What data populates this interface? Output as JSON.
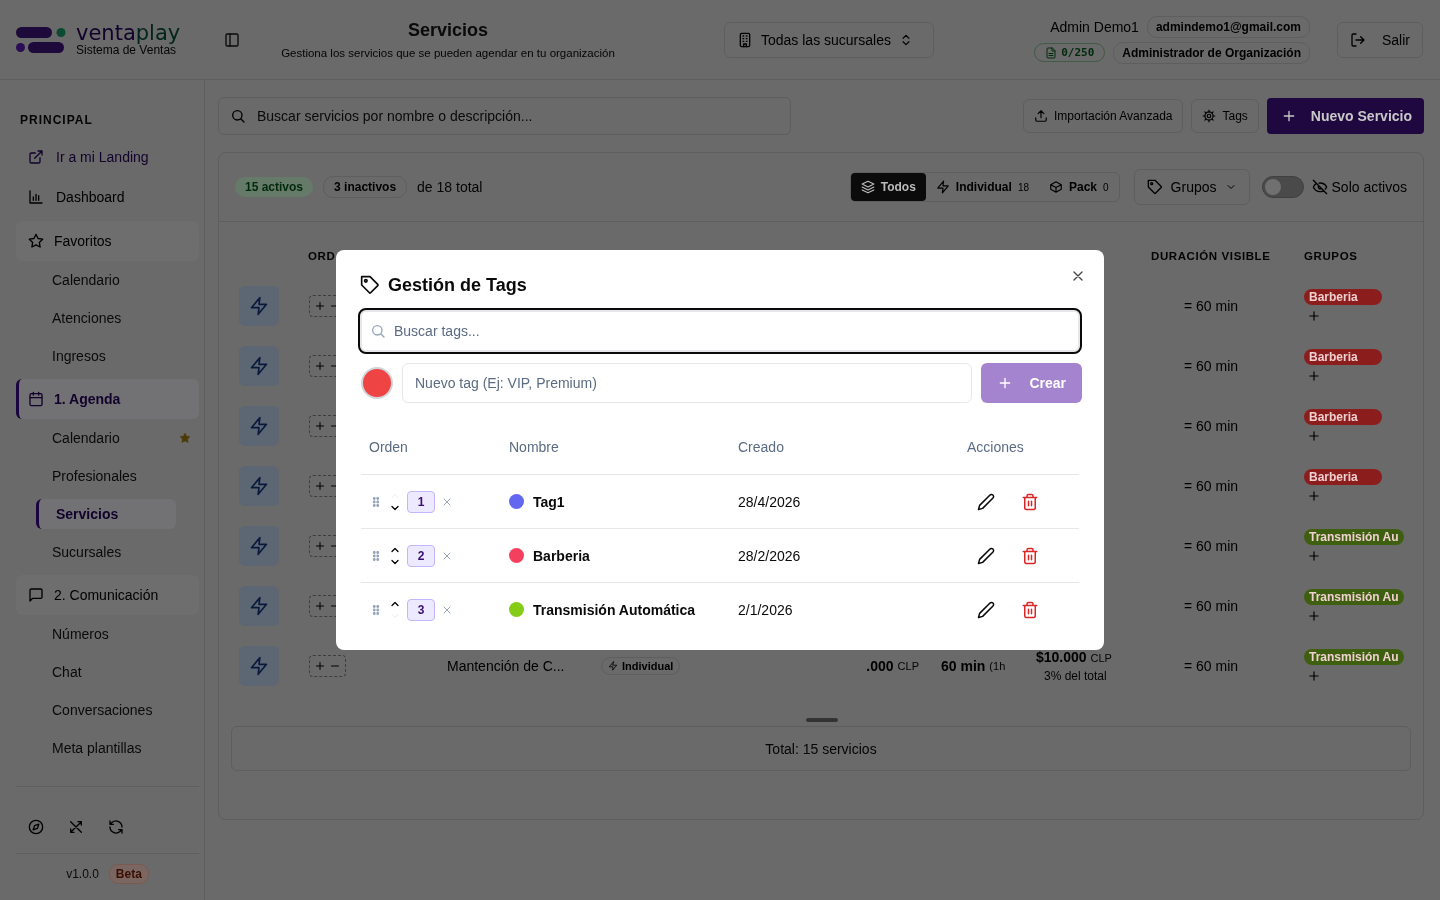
{
  "header": {
    "brand_prefix": "venta",
    "brand_suffix": "play",
    "brand_tagline": "Sistema de Ventas",
    "title": "Servicios",
    "subtitle": "Gestiona los servicios que se pueden agendar en tu organización",
    "branch_select": "Todas las sucursales",
    "user_name": "Admin Demo1",
    "user_email": "admindemo1@gmail.com",
    "credits": "0/250",
    "role": "Administrador de Organización",
    "logout": "Salir"
  },
  "sidebar": {
    "section": "PRINCIPAL",
    "links": [
      {
        "label": "Ir a mi Landing",
        "kind": "external"
      },
      {
        "label": "Dashboard",
        "kind": "chart"
      }
    ],
    "groups": [
      {
        "title": "Favoritos",
        "kind": "star",
        "active": false,
        "items": [
          {
            "label": "Calendario",
            "selected": false,
            "favorite": false
          },
          {
            "label": "Atenciones",
            "selected": false,
            "favorite": false
          },
          {
            "label": "Ingresos",
            "selected": false,
            "favorite": false
          }
        ]
      },
      {
        "title": "1. Agenda",
        "kind": "calendar",
        "active": true,
        "items": [
          {
            "label": "Calendario",
            "selected": false,
            "favorite": true
          },
          {
            "label": "Profesionales",
            "selected": false,
            "favorite": false
          },
          {
            "label": "Servicios",
            "selected": true,
            "favorite": false
          },
          {
            "label": "Sucursales",
            "selected": false,
            "favorite": false
          }
        ]
      },
      {
        "title": "2. Comunicación",
        "kind": "chat",
        "active": false,
        "items": [
          {
            "label": "Números",
            "selected": false,
            "favorite": false
          },
          {
            "label": "Chat",
            "selected": false,
            "favorite": false
          },
          {
            "label": "Conversaciones",
            "selected": false,
            "favorite": false
          },
          {
            "label": "Meta plantillas",
            "selected": false,
            "favorite": false
          }
        ]
      }
    ],
    "version": "v1.0.0",
    "badge": "Beta"
  },
  "toolbar": {
    "search_placeholder": "Buscar servicios por nombre o descripción...",
    "import": "Importación Avanzada",
    "tags": "Tags",
    "new": "Nuevo Servicio"
  },
  "stats": {
    "active": "15 activos",
    "inactive": "3 inactivos",
    "total": "de 18 total"
  },
  "filters": [
    {
      "label": "Todos",
      "selected": true
    },
    {
      "label": "Individual",
      "count": "18",
      "selected": false
    },
    {
      "label": "Pack",
      "count": "0",
      "selected": false
    }
  ],
  "groups_dropdown": "Grupos",
  "only_active": {
    "label": "Solo activos",
    "on": false
  },
  "table": {
    "columns": [
      "ORD",
      "DURACIÓN VISIBLE",
      "GRUPOS"
    ],
    "rows": [
      {
        "duration_visible": "= 60 min",
        "group": {
          "label": "Barberia",
          "color": "#8c1d1d"
        }
      },
      {
        "duration_visible": "= 60 min",
        "group": {
          "label": "Barberia",
          "color": "#8c1d1d"
        }
      },
      {
        "duration_visible": "= 60 min",
        "group": {
          "label": "Barberia",
          "color": "#8c1d1d"
        }
      },
      {
        "duration_visible": "= 60 min",
        "group": {
          "label": "Barberia",
          "color": "#8c1d1d"
        }
      },
      {
        "duration_visible": "= 60 min",
        "group": {
          "label": "Transmisión Au",
          "color": "#3f5f10"
        }
      },
      {
        "duration_visible": "= 60 min",
        "group": {
          "label": "Transmisión Au",
          "color": "#3f5f10"
        }
      },
      {
        "name": "Mantención de C...",
        "type": "Individual",
        "price": ".000",
        "price_unit": "CLP",
        "duration": "60 min",
        "duration_hint": "(1h",
        "total": "$10.000",
        "total_unit": "CLP",
        "share": "3% del total",
        "duration_visible": "= 60 min",
        "group": {
          "label": "Transmisión Au",
          "color": "#3f5f10"
        }
      }
    ],
    "footer": "Total: 15 servicios"
  },
  "tags_modal": {
    "title": "Gestión de Tags",
    "search_placeholder": "Buscar tags...",
    "new_placeholder": "Nuevo tag (Ej: VIP, Premium)",
    "create": "Crear",
    "columns": [
      "Orden",
      "Nombre",
      "Creado",
      "Acciones"
    ],
    "items": [
      {
        "order": "1",
        "up_disabled": true,
        "down_disabled": false,
        "name": "Tag1",
        "color": "#6366f1",
        "created": "28/4/2026"
      },
      {
        "order": "2",
        "up_disabled": false,
        "down_disabled": false,
        "name": "Barberia",
        "color": "#f43f5e",
        "created": "28/2/2026"
      },
      {
        "order": "3",
        "up_disabled": false,
        "down_disabled": true,
        "name": "Transmisión Automática",
        "color": "#84cc16",
        "created": "2/1/2026"
      }
    ]
  }
}
